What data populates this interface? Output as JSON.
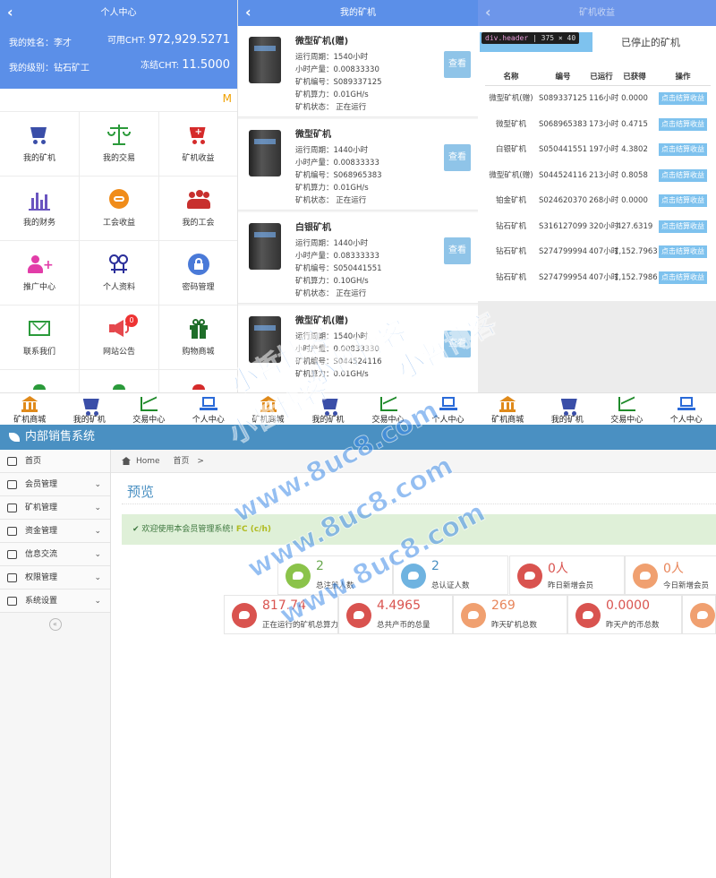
{
  "panel1": {
    "title": "个人中心",
    "name_label": "我的姓名：李才",
    "available_label": "可用CHT:",
    "available_value": "972,929.5271",
    "level_label": "我的级别：钻石矿工",
    "frozen_label": "冻结CHT:",
    "frozen_value": "11.5000",
    "marquee": "M",
    "grid": [
      {
        "label": "我的矿机",
        "icon": "cart-icon",
        "color": "#3a4ea8"
      },
      {
        "label": "我的交易",
        "icon": "scale-icon",
        "color": "#2a9a3a"
      },
      {
        "label": "矿机收益",
        "icon": "cart-plus-icon",
        "color": "#d52b2b"
      },
      {
        "label": "我的财务",
        "icon": "bar-chart-icon",
        "color": "#6a55c0"
      },
      {
        "label": "工会收益",
        "icon": "link-icon",
        "color": "#f08c1a"
      },
      {
        "label": "我的工会",
        "icon": "users-icon",
        "color": "#c8302e"
      },
      {
        "label": "推广中心",
        "icon": "user-plus-icon",
        "color": "#e23ca8"
      },
      {
        "label": "个人资料",
        "icon": "gender-icon",
        "color": "#2a2e9a"
      },
      {
        "label": "密码管理",
        "icon": "lock-icon",
        "color": "#4a7ad8"
      },
      {
        "label": "联系我们",
        "icon": "envelope-icon",
        "color": "#2a9a3a"
      },
      {
        "label": "网站公告",
        "icon": "megaphone-icon",
        "color": "#e5484d",
        "badge": "0"
      },
      {
        "label": "购物商城",
        "icon": "gift-icon",
        "color": "#1f6e2a"
      }
    ]
  },
  "panel2": {
    "title": "我的矿机",
    "items": [
      {
        "name": "微型矿机(赠)",
        "cycle": "运行周期：1540小时",
        "hourly": "小时产量：0.00833330",
        "serial": "矿机编号：S089337125",
        "power": "矿机算力：0.01GH/s",
        "status": "矿机状态： 正在运行",
        "button": "查看"
      },
      {
        "name": "微型矿机",
        "cycle": "运行周期：1440小时",
        "hourly": "小时产量：0.00833333",
        "serial": "矿机编号：S068965383",
        "power": "矿机算力：0.01GH/s",
        "status": "矿机状态： 正在运行",
        "button": "查看"
      },
      {
        "name": "白银矿机",
        "cycle": "运行周期：1440小时",
        "hourly": "小时产量：0.08333333",
        "serial": "矿机编号：S050441551",
        "power": "矿机算力：0.10GH/s",
        "status": "矿机状态： 正在运行",
        "button": "查看"
      },
      {
        "name": "微型矿机(赠)",
        "cycle": "运行周期：1540小时",
        "hourly": "小时产量：0.00833330",
        "serial": "矿机编号：S044524116",
        "power": "矿机算力：0.01GH/s",
        "status": "",
        "button": "查看"
      }
    ]
  },
  "panel3": {
    "title": "矿机收益",
    "tooltip_tag": "div.header",
    "tooltip_size": "375 × 40",
    "tab_stopped": "已停止的矿机",
    "headers": [
      "名称",
      "编号",
      "已运行",
      "已获得",
      "操作"
    ],
    "rows": [
      {
        "name": "微型矿机(赠)",
        "serial": "S089337125",
        "ran": "116小时",
        "earned": "0.0000",
        "action": "点击结算收益"
      },
      {
        "name": "微型矿机",
        "serial": "S068965383",
        "ran": "173小时",
        "earned": "0.4715",
        "action": "点击结算收益"
      },
      {
        "name": "白银矿机",
        "serial": "S050441551",
        "ran": "197小时",
        "earned": "4.3802",
        "action": "点击结算收益"
      },
      {
        "name": "微型矿机(赠)",
        "serial": "S044524116",
        "ran": "213小时",
        "earned": "0.8058",
        "action": "点击结算收益"
      },
      {
        "name": "铂金矿机",
        "serial": "S024620370",
        "ran": "268小时",
        "earned": "0.0000",
        "action": "点击结算收益"
      },
      {
        "name": "钻石矿机",
        "serial": "S316127099",
        "ran": "320小时",
        "earned": "427.6319",
        "action": "点击结算收益"
      },
      {
        "name": "钻石矿机",
        "serial": "S274799994",
        "ran": "407小时",
        "earned": "1,152.7963",
        "action": "点击结算收益"
      },
      {
        "name": "钻石矿机",
        "serial": "S274799954",
        "ran": "407小时",
        "earned": "1,152.7986",
        "action": "点击结算收益"
      }
    ]
  },
  "bottom_nav": [
    {
      "label": "矿机商城",
      "icon": "bank-icon",
      "color": "#e08a1a"
    },
    {
      "label": "我的矿机",
      "icon": "cart-icon",
      "color": "#3a4ea8"
    },
    {
      "label": "交易中心",
      "icon": "line-chart-icon",
      "color": "#1f8a2a"
    },
    {
      "label": "个人中心",
      "icon": "laptop-icon",
      "color": "#2a6ad8"
    }
  ],
  "admin": {
    "brand": "内部销售系统",
    "sidebar": [
      {
        "label": "首页",
        "icon": "dashboard-icon",
        "arrow": false
      },
      {
        "label": "会员管理",
        "icon": "edit-icon",
        "arrow": true
      },
      {
        "label": "矿机管理",
        "icon": "shuffle-icon",
        "arrow": true
      },
      {
        "label": "资金管理",
        "icon": "list-icon",
        "arrow": true
      },
      {
        "label": "信息交流",
        "icon": "calendar-icon",
        "arrow": true
      },
      {
        "label": "权限管理",
        "icon": "file-icon",
        "arrow": true
      },
      {
        "label": "系统设置",
        "icon": "text-icon",
        "arrow": true
      }
    ],
    "collapse_glyph": "«",
    "breadcrumb_home": "Home",
    "breadcrumb_page": "首页",
    "breadcrumb_sep": ">",
    "page_title": "预览",
    "alert_text": "欢迎使用本会员管理系统!",
    "alert_highlight": "FC (c/h)",
    "stats_row1": [
      {
        "value": "2",
        "label": "总注册人数",
        "color": "#8bc34a",
        "vcolor": "#6aa84f"
      },
      {
        "value": "2",
        "label": "总认证人数",
        "color": "#6fb3e0",
        "vcolor": "#4a90c2"
      },
      {
        "value": "0人",
        "label": "昨日新增会员",
        "color": "#d9534f",
        "vcolor": "#d9534f"
      },
      {
        "value": "0人",
        "label": "今日新增会员",
        "color": "#f0a070",
        "vcolor": "#e8855a"
      }
    ],
    "stats_row2": [
      {
        "value": "817.74",
        "label": "正在运行的矿机总算力",
        "color": "#d9534f",
        "vcolor": "#d9534f"
      },
      {
        "value": "4.4965",
        "label": "总共产币的总量",
        "color": "#d9534f",
        "vcolor": "#d9534f"
      },
      {
        "value": "269",
        "label": "昨天矿机总数",
        "color": "#f0a070",
        "vcolor": "#e8855a"
      },
      {
        "value": "0.0000",
        "label": "昨天产的币总数",
        "color": "#d9534f",
        "vcolor": "#d9534f"
      }
    ]
  },
  "watermarks": [
    "小哲博客",
    "小哲博客",
    "小哲博客",
    "小哲博客",
    "www.8uc8.com",
    "www.8uc8.com",
    "www.8uc8.com"
  ]
}
